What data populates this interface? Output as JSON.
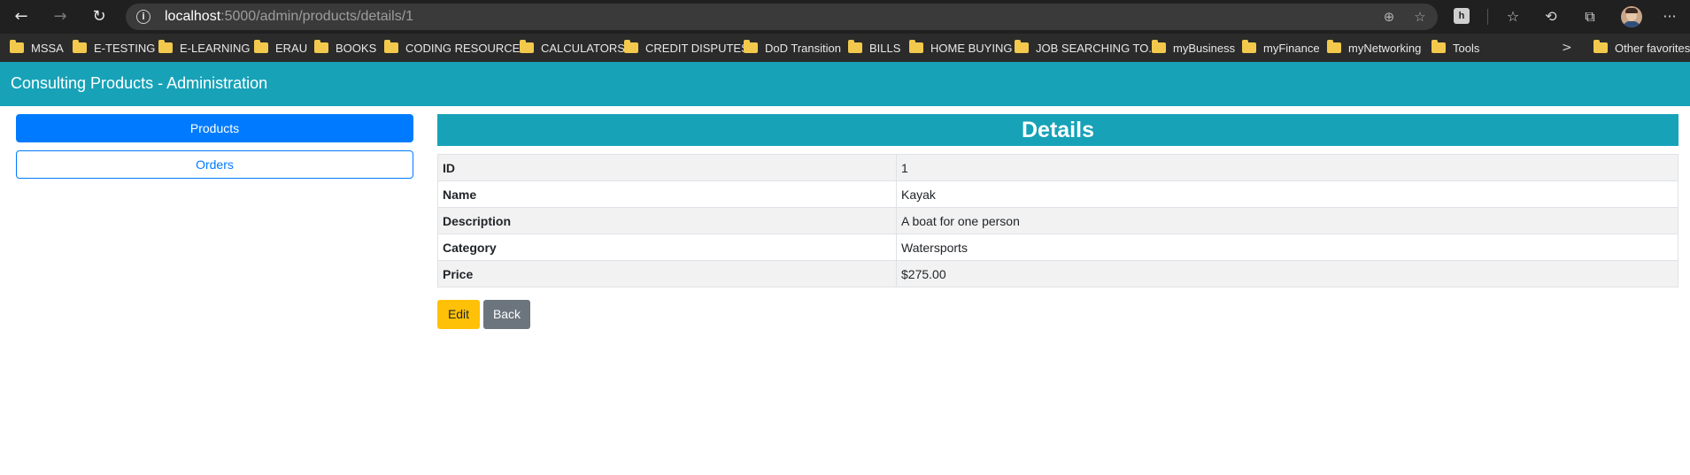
{
  "browser": {
    "url_host": "localhost",
    "url_path": ":5000/admin/products/details/1",
    "icons": {
      "back": "←",
      "forward": "→",
      "refresh": "↻",
      "info": "i",
      "zoom": "⊕",
      "favorite_add": "☆",
      "extension": "h",
      "favorites": "☆",
      "history": "⟲",
      "collections": "⧉",
      "more": "···"
    },
    "bookmarks": [
      "MSSA",
      "E-TESTING",
      "E-LEARNING",
      "ERAU",
      "BOOKS",
      "CODING RESOURCES",
      "CALCULATORS",
      "CREDIT DISPUTES",
      "DoD Transition",
      "BILLS",
      "HOME BUYING",
      "JOB SEARCHING TO...",
      "myBusiness",
      "myFinance",
      "myNetworking",
      "Tools"
    ],
    "bookmarks_more_icon": ">",
    "other_favorites": "Other favorites"
  },
  "app": {
    "title": "Consulting Products - Administration",
    "colors": {
      "header": "#17a2b8",
      "primary": "#007bff",
      "warning": "#ffc107",
      "secondary": "#6c757d"
    }
  },
  "sidebar": {
    "products_label": "Products",
    "orders_label": "Orders"
  },
  "details": {
    "title": "Details",
    "rows": [
      {
        "key": "ID",
        "value": "1"
      },
      {
        "key": "Name",
        "value": "Kayak"
      },
      {
        "key": "Description",
        "value": "A boat for one person"
      },
      {
        "key": "Category",
        "value": "Watersports"
      },
      {
        "key": "Price",
        "value": "$275.00"
      }
    ],
    "edit_label": "Edit",
    "back_label": "Back"
  }
}
